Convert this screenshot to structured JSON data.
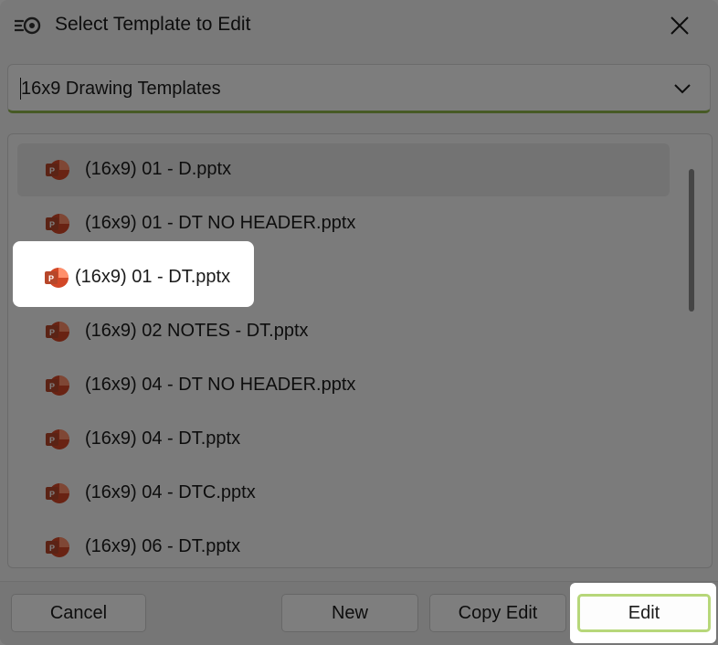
{
  "window": {
    "title": "Select Template to Edit"
  },
  "icons": {
    "app": "app-logo-icon",
    "close": "close-icon",
    "chevron": "chevron-down-icon",
    "file": "powerpoint-file-icon"
  },
  "template_set": {
    "value": "16x9 Drawing Templates"
  },
  "files": [
    {
      "name": "(16x9) 01 - D.pptx",
      "state": "hover"
    },
    {
      "name": "(16x9) 01 - DT NO HEADER.pptx"
    },
    {
      "name": "(16x9) 01 - DT.pptx",
      "state": "selected"
    },
    {
      "name": "(16x9) 02 NOTES - DT.pptx"
    },
    {
      "name": "(16x9) 04 - DT NO HEADER.pptx"
    },
    {
      "name": "(16x9) 04 - DT.pptx"
    },
    {
      "name": "(16x9) 04 - DTC.pptx"
    },
    {
      "name": "(16x9) 06 - DT.pptx"
    }
  ],
  "buttons": {
    "cancel": "Cancel",
    "new": "New",
    "copy_edit": "Copy Edit",
    "edit": "Edit"
  },
  "colors": {
    "accent": "#8fb54a",
    "powerpoint": "#d24726",
    "overlay": "rgba(0,0,0,0.5)"
  }
}
